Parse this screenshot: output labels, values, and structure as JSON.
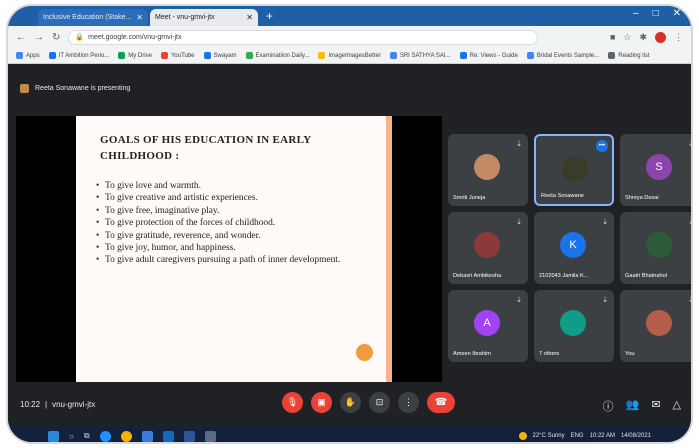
{
  "browser": {
    "tabs": [
      {
        "label": "Inclusive Education (Stake...",
        "active": false
      },
      {
        "label": "Meet - vnu-gmvi-jtx",
        "active": true
      }
    ],
    "new_tab": "+",
    "window_controls": [
      "–",
      "□",
      "✕"
    ],
    "address": "meet.google.com/vnu-gmvi-jtx",
    "bookmarks": [
      {
        "label": "Apps",
        "color": "#4285f4"
      },
      {
        "label": "IT Ambition Perio...",
        "color": "#1a73e8"
      },
      {
        "label": "My Drive",
        "color": "#0f9d58"
      },
      {
        "label": "YouTube",
        "color": "#ea4335"
      },
      {
        "label": "Swayam",
        "color": "#1a73e8"
      },
      {
        "label": "Examinatiion Daily...",
        "color": "#34a853"
      },
      {
        "label": "ImageImagesBetter",
        "color": "#fbbc04"
      },
      {
        "label": "SRI SATHYA SAI...",
        "color": "#4285f4"
      },
      {
        "label": "Re: Views - Guide",
        "color": "#1a73e8"
      },
      {
        "label": "Bridal Events Sample...",
        "color": "#4285f4"
      },
      {
        "label": "Reading list",
        "color": "#5f6368"
      }
    ]
  },
  "meet": {
    "presenting_text": "Reeta Sonawane is presenting",
    "slide": {
      "title": "Goals of his education in early childhood :",
      "items": [
        "To give  love and warmth.",
        "To give creative and artistic experiences.",
        "To give  free, imaginative play.",
        "To give  protection of the forces of childhood.",
        "To give gratitude, reverence, and wonder.",
        "To give  joy, humor, and happiness.",
        "To give  adult caregivers pursuing a path of inner development."
      ]
    },
    "participants": [
      {
        "name": "Smriti Juneja",
        "initial": "",
        "color": "#c48a64",
        "active": false
      },
      {
        "name": "Reeta Sonawane",
        "initial": "",
        "color": "#3b3b2a",
        "active": true
      },
      {
        "name": "Shreya Desai",
        "initial": "S",
        "color": "#8e44ad",
        "active": false
      },
      {
        "name": "Debasri Ambikesha",
        "initial": "",
        "color": "#8b3a3a",
        "active": false
      },
      {
        "name": "2102043 Jamila K...",
        "initial": "K",
        "color": "#1a73e8",
        "active": false
      },
      {
        "name": "Gaatri Bhatnahol",
        "initial": "",
        "color": "#2d5a3a",
        "active": false
      },
      {
        "name": "Ameen Ibrahim",
        "initial": "A",
        "color": "#a142f4",
        "active": false
      },
      {
        "name": "7 others",
        "initial": "",
        "color": "#0f9d88",
        "active": false
      },
      {
        "name": "You",
        "initial": "",
        "color": "#b55f4a",
        "active": false
      }
    ],
    "time": "10:22",
    "meeting_code": "vnu-gmvi-jtx",
    "badge_label": "•••"
  },
  "taskbar": {
    "weather": "22°C Sunny",
    "time": "10:22 AM",
    "date": "14/08/2021",
    "lang": "ENG"
  }
}
